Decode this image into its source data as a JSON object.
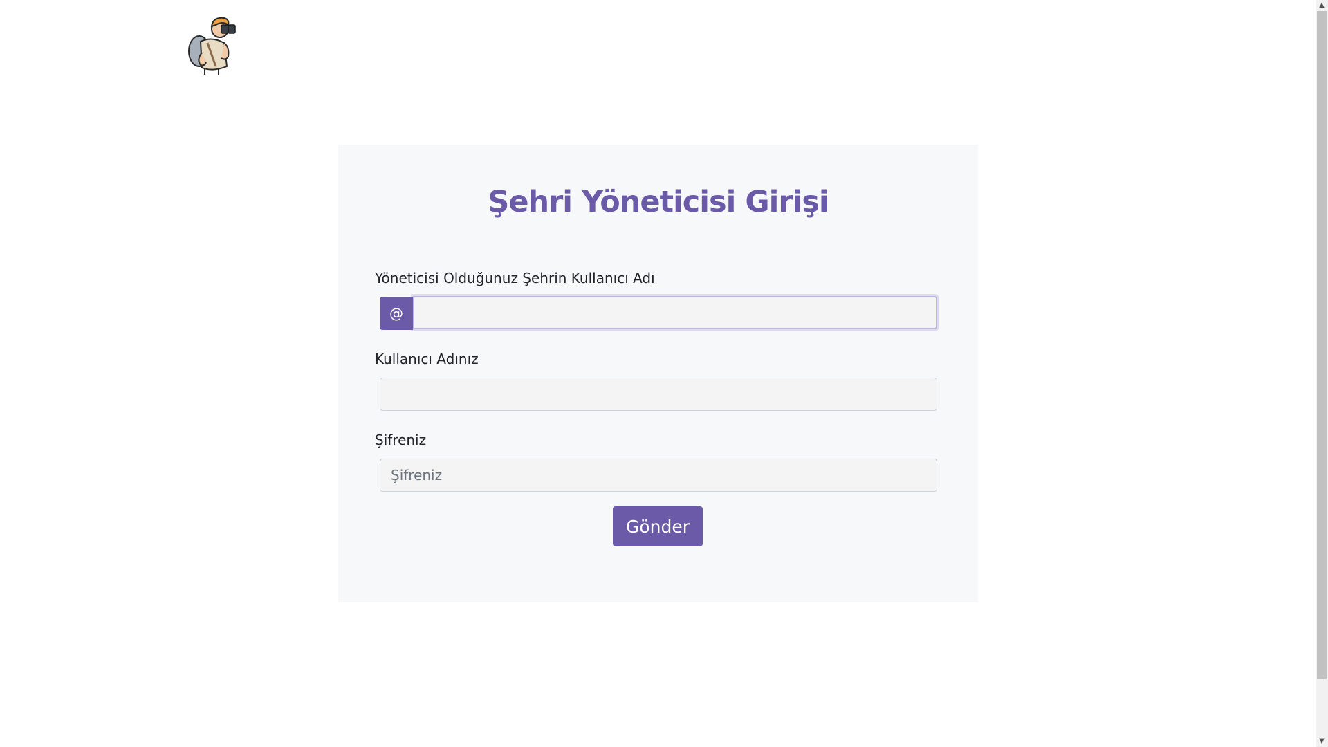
{
  "logo": {
    "icon": "explorer-with-binoculars-icon"
  },
  "form": {
    "title": "Şehri Yöneticisi Girişi",
    "city_username": {
      "label": "Yöneticisi Olduğunuz Şehrin Kullanıcı Adı",
      "addon": "@",
      "value": "",
      "placeholder": ""
    },
    "username": {
      "label": "Kullanıcı Adınız",
      "value": "",
      "placeholder": ""
    },
    "password": {
      "label": "Şifreniz",
      "value": "",
      "placeholder": "Şifreniz"
    },
    "submit_label": "Gönder"
  },
  "colors": {
    "accent": "#6a5aa8",
    "card_background": "#f7f8fa",
    "input_background": "#f4f4f5"
  }
}
